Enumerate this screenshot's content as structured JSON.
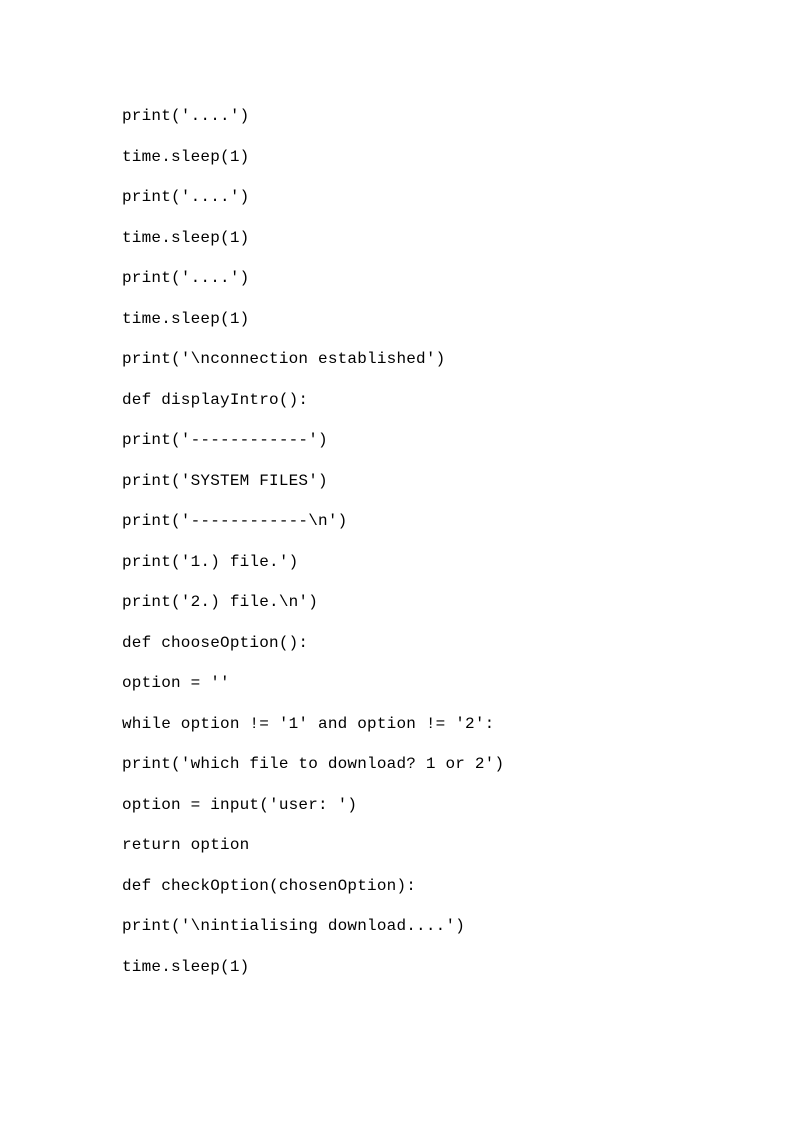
{
  "code": {
    "lines": [
      "print('....')",
      "time.sleep(1)",
      "print('....')",
      "time.sleep(1)",
      "print('....')",
      "time.sleep(1)",
      "print('\\nconnection established')",
      "def displayIntro():",
      "print('------------')",
      "print('SYSTEM FILES')",
      "print('------------\\n')",
      "print('1.) file.')",
      "print('2.) file.\\n')",
      "def chooseOption():",
      "option = ''",
      "while option != '1' and option != '2':",
      "print('which file to download? 1 or 2')",
      "option = input('user: ')",
      "return option",
      "def checkOption(chosenOption):",
      "print('\\nintialising download....')",
      "time.sleep(1)"
    ]
  }
}
